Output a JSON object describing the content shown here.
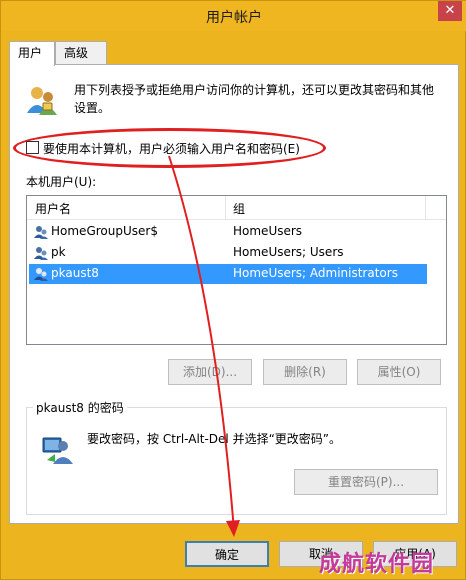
{
  "window": {
    "title": "用户帐户",
    "close_label": "✕"
  },
  "tabs": [
    {
      "label": "用户"
    },
    {
      "label": "高级"
    }
  ],
  "info": {
    "text": "用下列表授予或拒绝用户访问你的计算机，还可以更改其密码和其他设置。"
  },
  "checkbox": {
    "label": "要使用本计算机，用户必须输入用户名和密码(E)",
    "checked": false
  },
  "users": {
    "label": "本机用户(U):",
    "columns": [
      "用户名",
      "组"
    ],
    "rows": [
      {
        "name": "HomeGroupUser$",
        "group": "HomeUsers",
        "selected": false
      },
      {
        "name": "pk",
        "group": "HomeUsers; Users",
        "selected": false
      },
      {
        "name": "pkaust8",
        "group": "HomeUsers; Administrators",
        "selected": true
      }
    ]
  },
  "user_buttons": {
    "add": "添加(D)...",
    "remove": "删除(R)",
    "properties": "属性(O)"
  },
  "password": {
    "group_title": "pkaust8 的密码",
    "text": "要改密码，按 Ctrl-Alt-Del 并选择“更改密码”。",
    "reset_label": "重置密码(P)..."
  },
  "footer": {
    "ok": "确定",
    "cancel": "取消",
    "apply": "应用(A)"
  },
  "watermark": "成航软件园",
  "colors": {
    "frame": "#ecb41f",
    "selection": "#3399ff",
    "annotation": "#e02020"
  }
}
